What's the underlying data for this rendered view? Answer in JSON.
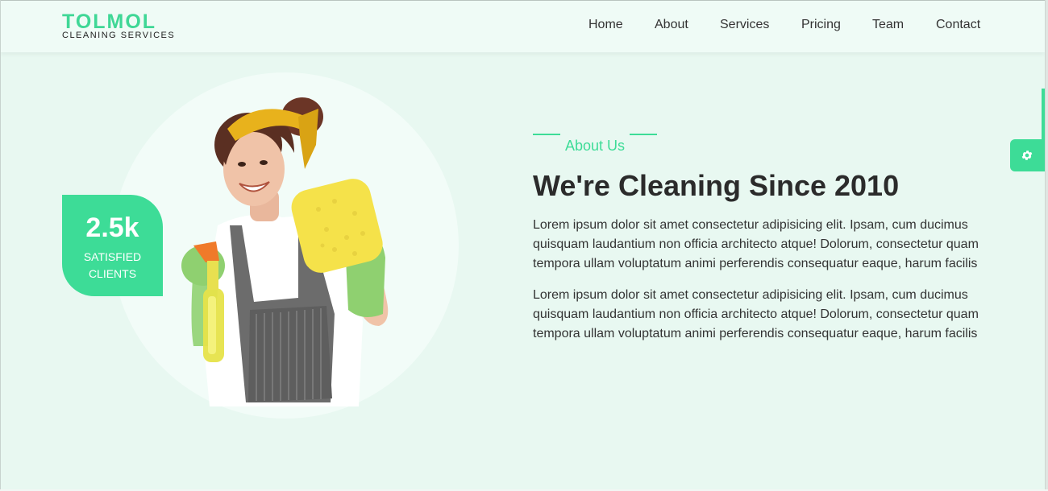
{
  "brand": {
    "title": "TOLMOL",
    "subtitle": "CLEANING SERVICES"
  },
  "nav": {
    "items": [
      {
        "label": "Home"
      },
      {
        "label": "About"
      },
      {
        "label": "Services"
      },
      {
        "label": "Pricing"
      },
      {
        "label": "Team"
      },
      {
        "label": "Contact"
      }
    ]
  },
  "stat": {
    "value": "2.5k",
    "label": "SATISFIED CLIENTS"
  },
  "about": {
    "eyebrow": "About Us",
    "heading": "We're Cleaning Since 2010",
    "paragraphs": [
      "Lorem ipsum dolor sit amet consectetur adipisicing elit. Ipsam, cum ducimus quisquam laudantium non officia architecto atque! Dolorum, consectetur quam tempora ullam voluptatum animi perferendis consequatur eaque, harum facilis",
      "Lorem ipsum dolor sit amet consectetur adipisicing elit. Ipsam, cum ducimus quisquam laudantium non officia architecto atque! Dolorum, consectetur quam tempora ullam voluptatum animi perferendis consequatur eaque, harum facilis"
    ]
  },
  "settings": {
    "icon": "gear-icon"
  },
  "colors": {
    "accent": "#3ddc97",
    "background": "#e8f8f1",
    "header": "#effbf6",
    "heading_text": "#2b2b2b"
  }
}
